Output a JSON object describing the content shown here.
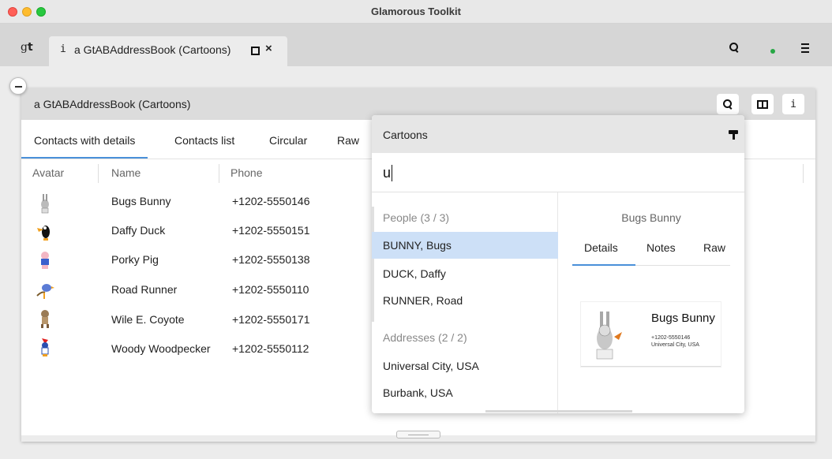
{
  "window": {
    "title": "Glamorous Toolkit"
  },
  "tabbar": {
    "logo_g": "g",
    "logo_t": "t",
    "tab": {
      "info_glyph": "i",
      "label": "a GtABAddressBook (Cartoons)",
      "close_glyph": "×"
    }
  },
  "inspector": {
    "title": "a GtABAddressBook (Cartoons)",
    "header_buttons": [
      "search-icon",
      "book-icon",
      "info-icon"
    ],
    "info_glyph": "i",
    "views": [
      "Contacts with details",
      "Contacts list",
      "Circular",
      "Raw"
    ],
    "active_view": "Contacts with details",
    "columns": [
      "Avatar",
      "Name",
      "Phone"
    ],
    "rows": [
      {
        "name": "Bugs Bunny",
        "phone": "+1202-5550146"
      },
      {
        "name": "Daffy Duck",
        "phone": "+1202-5550151"
      },
      {
        "name": "Porky Pig",
        "phone": "+1202-5550138"
      },
      {
        "name": "Road Runner",
        "phone": "+1202-5550110"
      },
      {
        "name": "Wile E. Coyote",
        "phone": "+1202-5550171"
      },
      {
        "name": "Woody Woodpecker",
        "phone": "+1202-5550112"
      }
    ]
  },
  "spotter": {
    "title": "Cartoons",
    "query": "u",
    "categories": [
      {
        "label": "People (3 / 3)",
        "items": [
          "BUNNY, Bugs",
          "DUCK, Daffy",
          "RUNNER, Road"
        ]
      },
      {
        "label": "Addresses (2 / 2)",
        "items": [
          "Universal City, USA",
          "Burbank, USA"
        ]
      }
    ],
    "selected_item": "BUNNY, Bugs",
    "preview": {
      "title": "Bugs Bunny",
      "tabs": [
        "Details",
        "Notes",
        "Raw"
      ],
      "active_tab": "Details",
      "card": {
        "name": "Bugs Bunny",
        "phone": "+1202-5550146",
        "address": "Universal City, USA"
      }
    }
  },
  "colors": {
    "accent": "#4a90d9",
    "selection": "#cde0f7",
    "status_dot": "#27a745"
  }
}
